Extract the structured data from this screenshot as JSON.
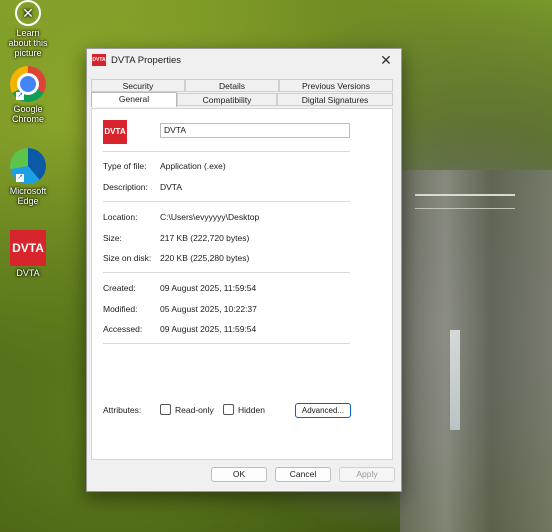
{
  "desktop": {
    "icons": [
      {
        "label": "Learn about this picture",
        "icon": "info-circle-icon"
      },
      {
        "label": "Google Chrome",
        "icon": "chrome-icon"
      },
      {
        "label": "Microsoft Edge",
        "icon": "edge-icon"
      },
      {
        "label": "DVTA",
        "icon": "dvta-icon"
      }
    ],
    "dvta_icon_text": "DVTA"
  },
  "dialog": {
    "title": "DVTA Properties",
    "title_icon_text": "DVTA",
    "close_glyph": "✕",
    "tabs_row1": [
      "Security",
      "Details",
      "Previous Versions"
    ],
    "tabs_row2": [
      "General",
      "Compatibility",
      "Digital Signatures"
    ],
    "active_tab": "General",
    "general": {
      "icon_text": "DVTA",
      "file_name": "DVTA",
      "type_label": "Type of file:",
      "type_value": "Application (.exe)",
      "description_label": "Description:",
      "description_value": "DVTA",
      "location_label": "Location:",
      "location_value": "C:\\Users\\evyyyyy\\Desktop",
      "size_label": "Size:",
      "size_value": "217 KB (222,720 bytes)",
      "size_on_disk_label": "Size on disk:",
      "size_on_disk_value": "220 KB (225,280 bytes)",
      "created_label": "Created:",
      "created_value": "09 August 2025, 11:59:54",
      "modified_label": "Modified:",
      "modified_value": "05 August 2025, 10:22:37",
      "accessed_label": "Accessed:",
      "accessed_value": "09 August 2025, 11:59:54",
      "attributes_label": "Attributes:",
      "readonly_label": "Read-only",
      "hidden_label": "Hidden",
      "advanced_label": "Advanced..."
    },
    "buttons": {
      "ok": "OK",
      "cancel": "Cancel",
      "apply": "Apply"
    }
  },
  "colors": {
    "dvta_red": "#d8242c",
    "accent": "#0067c0"
  }
}
